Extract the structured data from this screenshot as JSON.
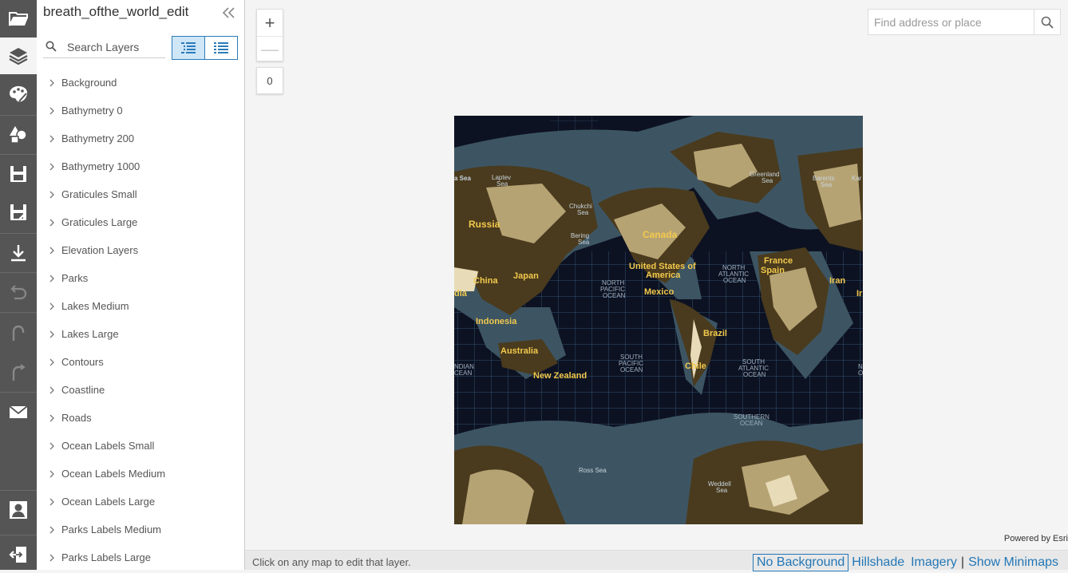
{
  "colors": {
    "accent": "#2377b6",
    "rail": "#555555",
    "ocean": "#0d1222",
    "land_dark": "#4a3b1e",
    "land_light": "#e8dcb8",
    "label_gold": "#f2c94c"
  },
  "rail": {
    "icons": [
      "folder-open-icon",
      "layers-icon",
      "palette-icon",
      "shapes-icon",
      "save-icon",
      "save-as-icon",
      "download-icon",
      "undo-icon",
      "redo-icon",
      "redo-alt-icon",
      "mail-icon",
      "user-icon",
      "sign-out-icon"
    ]
  },
  "panel": {
    "title": "breath_ofthe_world_edit",
    "search_placeholder": "Search Layers",
    "layers": [
      "Background",
      "Bathymetry 0",
      "Bathymetry 200",
      "Bathymetry 1000",
      "Graticules Small",
      "Graticules Large",
      "Elevation Layers",
      "Parks",
      "Lakes Medium",
      "Lakes Large",
      "Contours",
      "Coastline",
      "Roads",
      "Ocean Labels Small",
      "Ocean Labels Medium",
      "Ocean Labels Large",
      "Parks Labels Medium",
      "Parks Labels Large"
    ]
  },
  "map": {
    "zoom_in": "+",
    "zoom_out": "—",
    "zoom_level": "0",
    "search_placeholder": "Find address or place",
    "powered_by": "Powered by Esri",
    "labels": {
      "laptev": "Laptev",
      "laptev2": "Sea",
      "kara": "a Sea",
      "greenland": "Greenland",
      "greenland2": "Sea",
      "barents": "Barents",
      "barents2": "Sea",
      "kar": "Kar",
      "chukchi": "Chukchi",
      "chukchi2": "Sea",
      "bering": "Bering",
      "bering2": "Sea",
      "russia": "Russia",
      "canada": "Canada",
      "usa": "United States of",
      "usa2": "America",
      "france": "France",
      "spain": "Spain",
      "iran": "Iran",
      "ir": "Ir",
      "china": "China",
      "japan": "Japan",
      "india": "dia",
      "mexico": "Mexico",
      "npac1": "NORTH",
      "npac2": "PACIFIC",
      "npac3": "OCEAN",
      "natl1": "NORTH",
      "natl2": "ATLANTIC",
      "natl3": "OCEAN",
      "indonesia": "Indonesia",
      "australia": "Australia",
      "brazil": "Brazil",
      "nz": "New Zealand",
      "chile": "Chile",
      "spac1": "SOUTH",
      "spac2": "PACIFIC",
      "spac3": "OCEAN",
      "satl1": "SOUTH",
      "satl2": "ATLANTIC",
      "satl3": "OCEAN",
      "indian1": "NDIAN",
      "indian2": "CEAN",
      "ind_r": "NC",
      "ind_r2": "OC",
      "south1": "SOUTHERN",
      "south2": "OCEAN",
      "ross": "Ross Sea",
      "weddell": "Weddell",
      "weddell2": "Sea"
    }
  },
  "status": {
    "hint": "Click on any map to edit that layer.",
    "links": [
      "No Background",
      "Hillshade",
      "Imagery",
      "Show Minimaps"
    ],
    "selected_link": "No Background"
  }
}
